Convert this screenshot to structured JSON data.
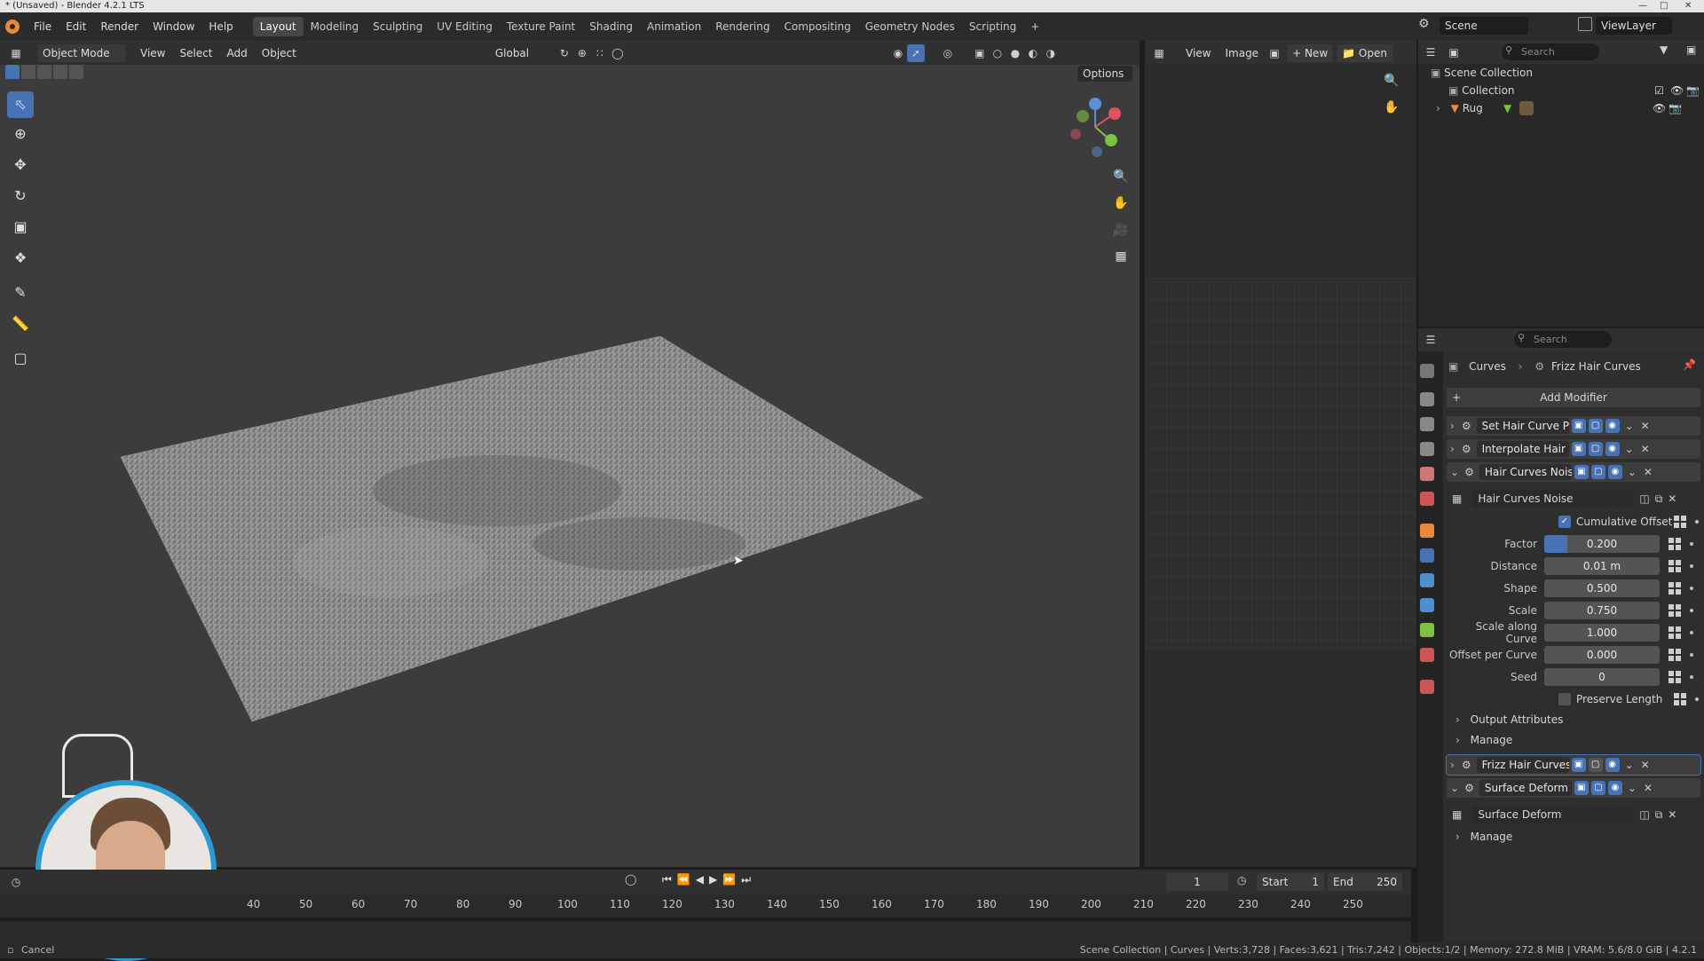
{
  "window_title": "* (Unsaved) - Blender 4.2.1 LTS",
  "menu": [
    "File",
    "Edit",
    "Render",
    "Window",
    "Help"
  ],
  "workspaces": [
    "Layout",
    "Modeling",
    "Sculpting",
    "UV Editing",
    "Texture Paint",
    "Shading",
    "Animation",
    "Rendering",
    "Compositing",
    "Geometry Nodes",
    "Scripting"
  ],
  "active_workspace": "Layout",
  "scene_name": "Scene",
  "view_layer": "ViewLayer",
  "viewport": {
    "mode": "Object Mode",
    "menus": [
      "View",
      "Select",
      "Add",
      "Object"
    ],
    "orientation": "Global",
    "options_label": "Options"
  },
  "image_editor": {
    "menus": [
      "View",
      "Image"
    ],
    "new_label": "New",
    "open_label": "Open"
  },
  "outliner": {
    "search_placeholder": "Search",
    "items": [
      {
        "label": "Scene Collection"
      },
      {
        "label": "Collection"
      },
      {
        "label": "Rug"
      }
    ]
  },
  "properties": {
    "search_placeholder": "Search",
    "breadcrumb": [
      "Curves",
      "Frizz Hair Curves"
    ],
    "add_modifier": "Add Modifier",
    "modifiers_collapsed": [
      "Set Hair Curve Pro...",
      "Interpolate Hair C..."
    ],
    "noise_modifier": "Hair Curves Noise",
    "node_group": "Hair Curves Noise",
    "cumulative_offset": "Cumulative Offset",
    "fields": [
      {
        "label": "Factor",
        "value": "0.200",
        "fill": 0.2
      },
      {
        "label": "Distance",
        "value": "0.01 m"
      },
      {
        "label": "Shape",
        "value": "0.500"
      },
      {
        "label": "Scale",
        "value": "0.750"
      },
      {
        "label": "Scale along Curve",
        "value": "1.000"
      },
      {
        "label": "Offset per Curve",
        "value": "0.000"
      },
      {
        "label": "Seed",
        "value": "0"
      }
    ],
    "preserve_length": "Preserve Length",
    "output_attributes": "Output Attributes",
    "manage": "Manage",
    "frizz_modifier": "Frizz Hair Curves",
    "surface_modifier": "Surface Deform",
    "surface_node_group": "Surface Deform",
    "manage2": "Manage"
  },
  "timeline": {
    "current_frame": "1",
    "start_label": "Start",
    "start": "1",
    "end_label": "End",
    "end": "250",
    "ticks": [
      "40",
      "50",
      "60",
      "70",
      "80",
      "90",
      "100",
      "110",
      "120",
      "130",
      "140",
      "150",
      "160",
      "170",
      "180",
      "190",
      "200",
      "210",
      "220",
      "230",
      "240",
      "250"
    ]
  },
  "status": {
    "left": "Cancel",
    "right": "Scene Collection | Curves | Verts:3,728 | Faces:3,621 | Tris:7,242 | Objects:1/2 | Memory: 272.8 MiB | VRAM: 5.6/8.0 GiB | 4.2.1"
  }
}
